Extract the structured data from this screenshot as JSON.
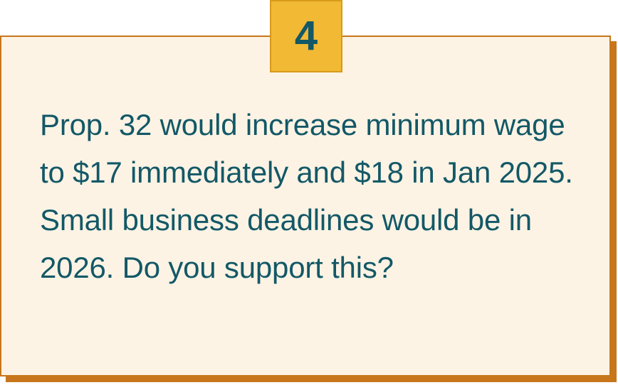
{
  "badge": {
    "number": "4"
  },
  "question": {
    "text": "Prop. 32 would increase minimum wage to $17 immediately and $18 in Jan 2025. Small business deadlines would be in 2026. Do you support this?"
  },
  "colors": {
    "card_background": "#fcf3e4",
    "card_border": "#c8761b",
    "badge_background": "#f1b934",
    "text": "#135867"
  }
}
